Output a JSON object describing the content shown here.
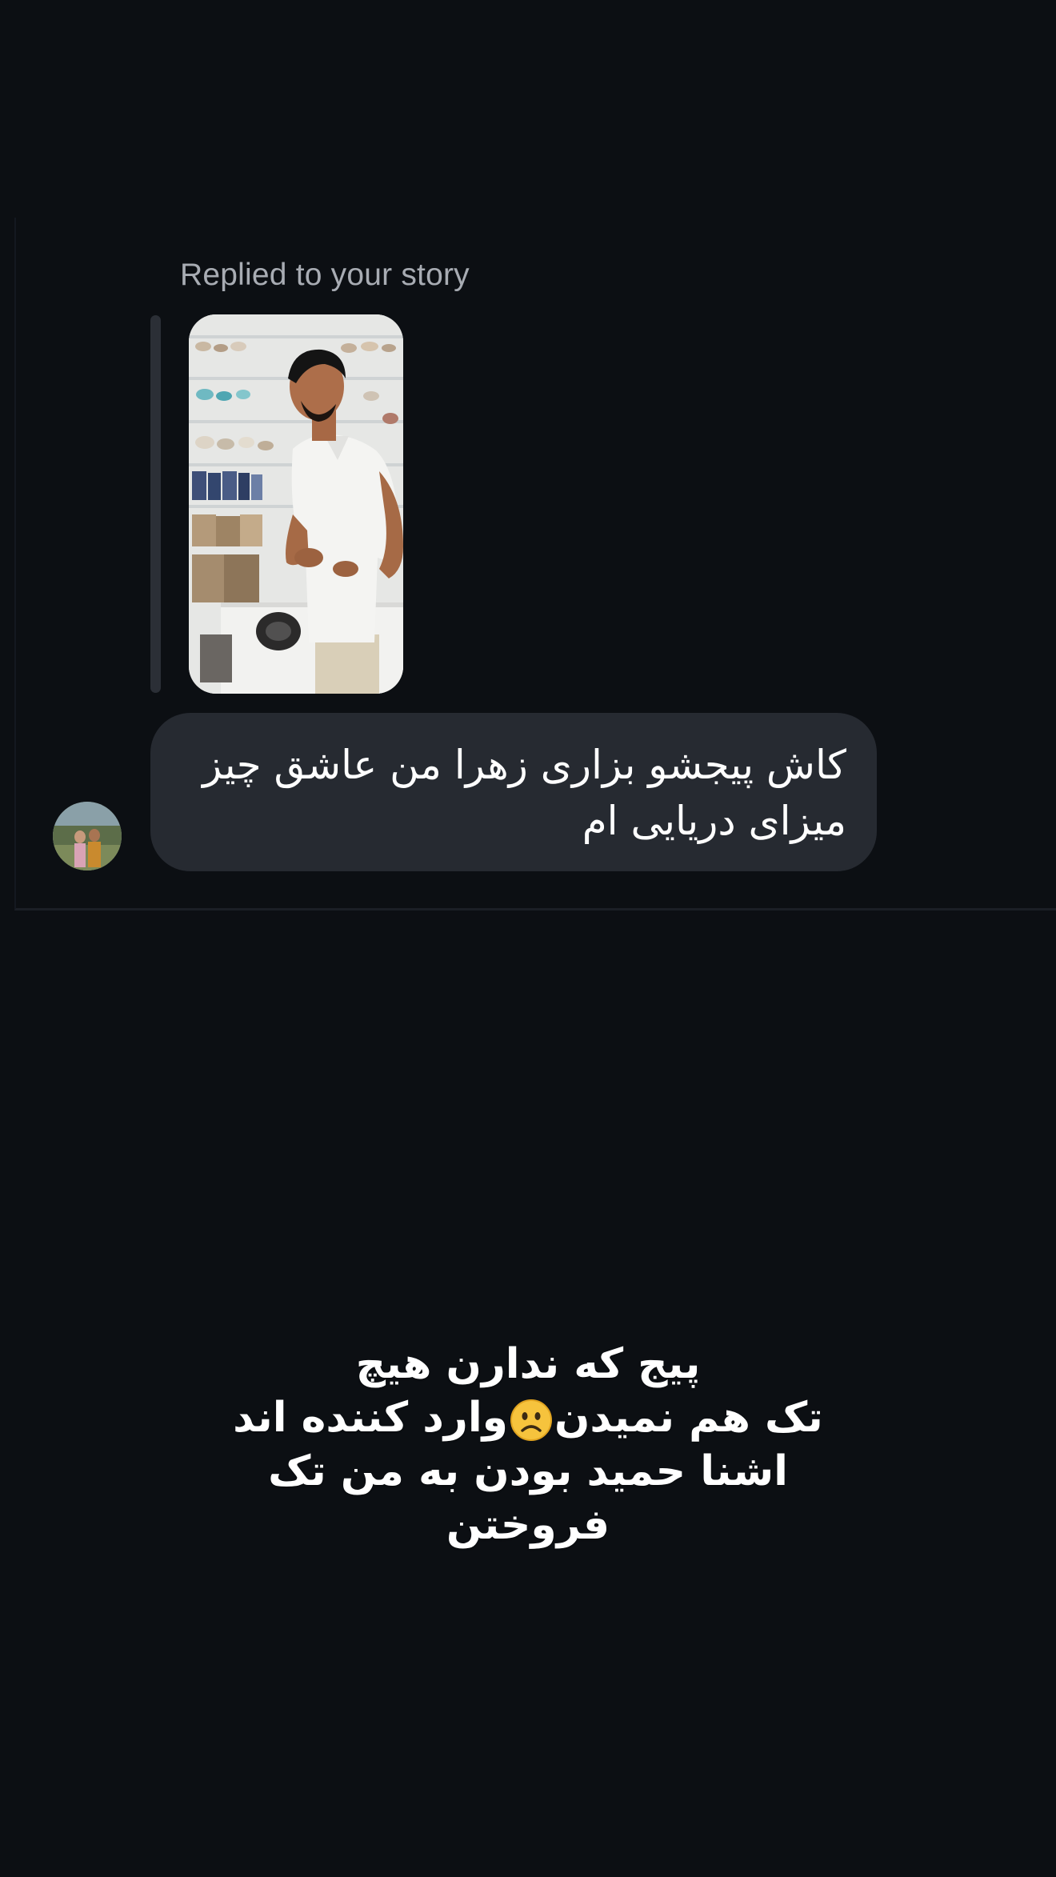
{
  "reply_label": "Replied to your story",
  "message": {
    "text": "کاش پیجشو بزاری زهرا من عاشق چیز میزای دریایی ام"
  },
  "story_caption": {
    "line1": "پیج که ندارن هیچ",
    "line2_before_emoji": "تک هم نمیدن",
    "emoji": "slightly-frowning-face-emoji",
    "line2_after_emoji": "وارد کننده اند",
    "line3": "اشنا حمید بودن به من تک",
    "line4": "فروختن"
  },
  "colors": {
    "background": "#0c0f13",
    "bubble": "#262a31",
    "reply_label": "#a8acb3",
    "quote_bar": "#2b2f36"
  }
}
